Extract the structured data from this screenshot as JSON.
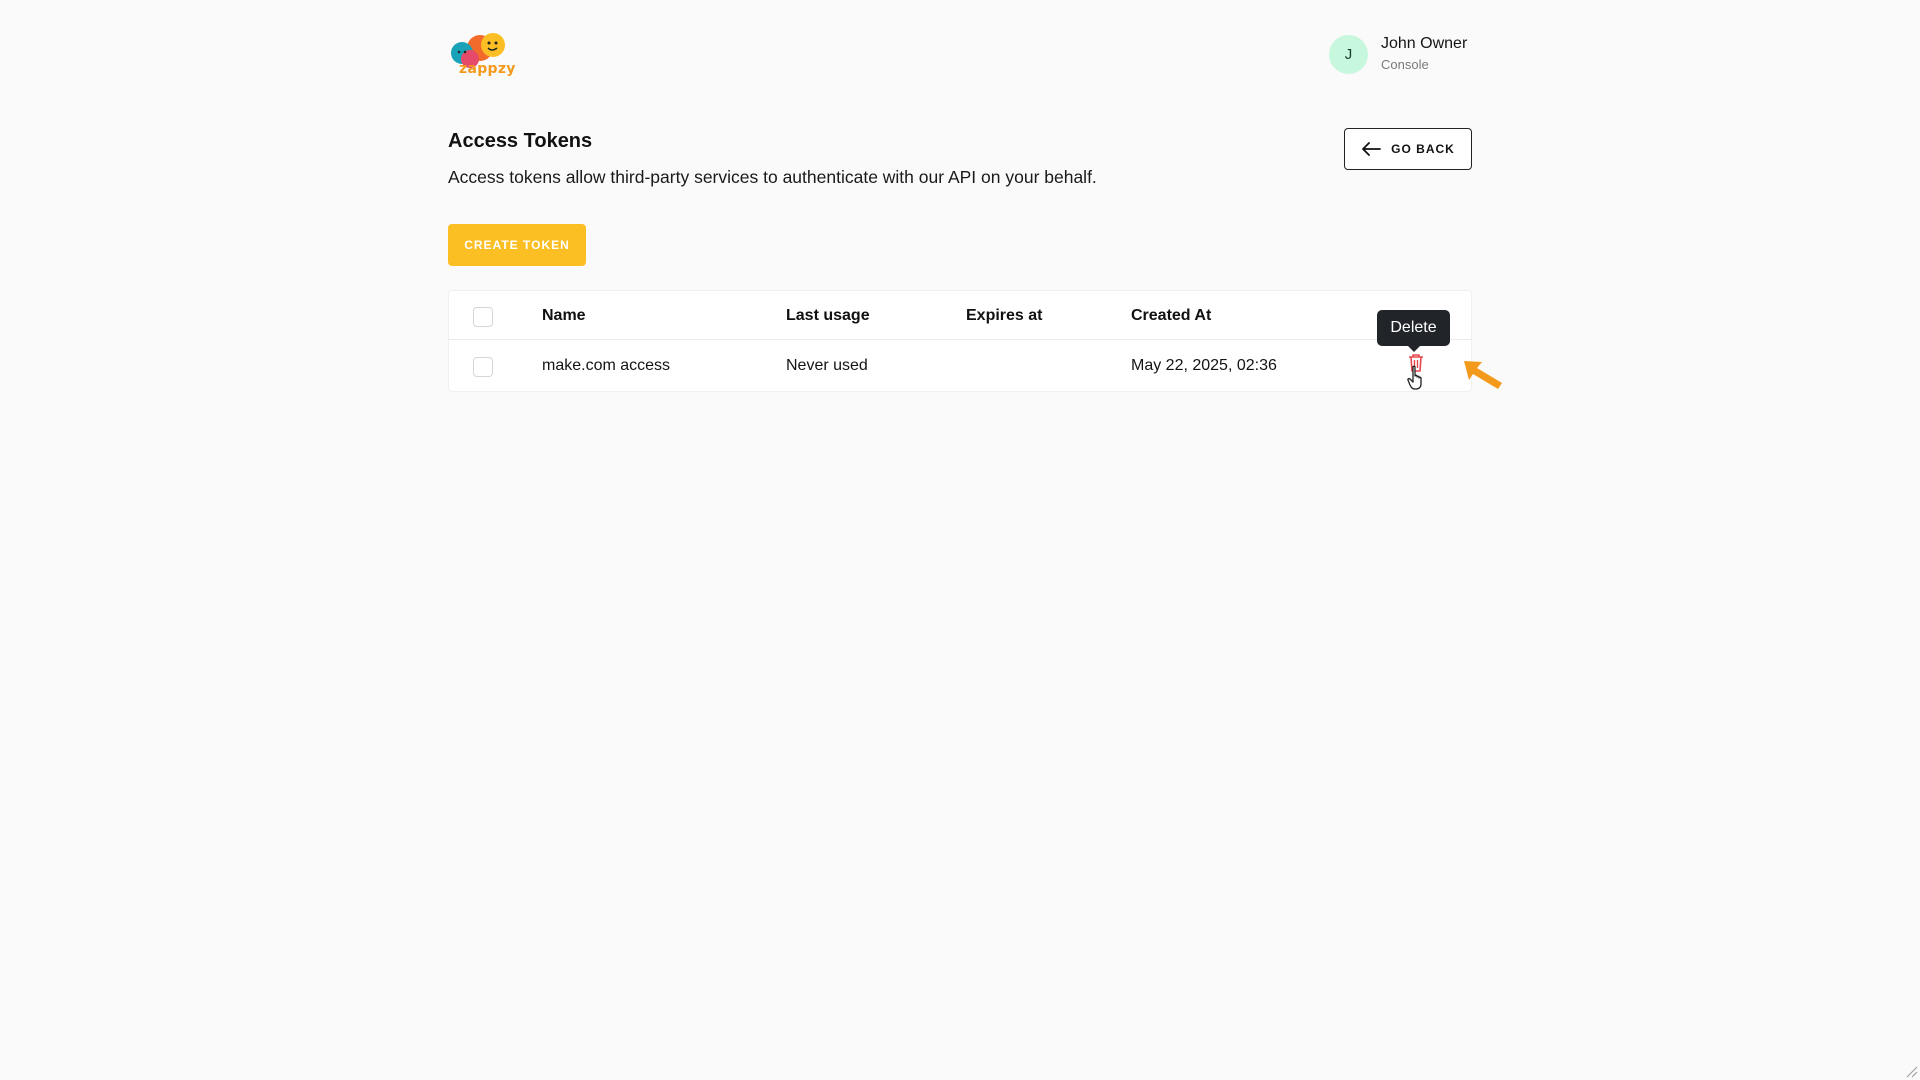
{
  "app": {
    "logo_text": "zappzy",
    "colors": {
      "accent": "#fbbf24",
      "brand_orange": "#f39a1c",
      "avatar_bg": "#c7f7dd",
      "danger": "#e5484d"
    }
  },
  "user": {
    "initial": "J",
    "name": "John Owner",
    "role": "Console"
  },
  "page": {
    "title": "Access Tokens",
    "description": "Access tokens allow third-party services to authenticate with our API on your behalf.",
    "go_back_label": "GO BACK",
    "create_label": "CREATE TOKEN"
  },
  "table": {
    "columns": [
      "Name",
      "Last usage",
      "Expires at",
      "Created At"
    ],
    "rows": [
      {
        "name": "make.com access",
        "last_usage": "Never used",
        "expires_at": "",
        "created_at": "May 22, 2025, 02:36"
      }
    ]
  },
  "tooltip": {
    "text": "Delete"
  },
  "icons": {
    "logo": "zappzy-logo",
    "back": "arrow-left-icon",
    "delete": "trash-icon",
    "cursor": "hand-pointer-icon",
    "annotation": "orange-arrow-icon"
  }
}
